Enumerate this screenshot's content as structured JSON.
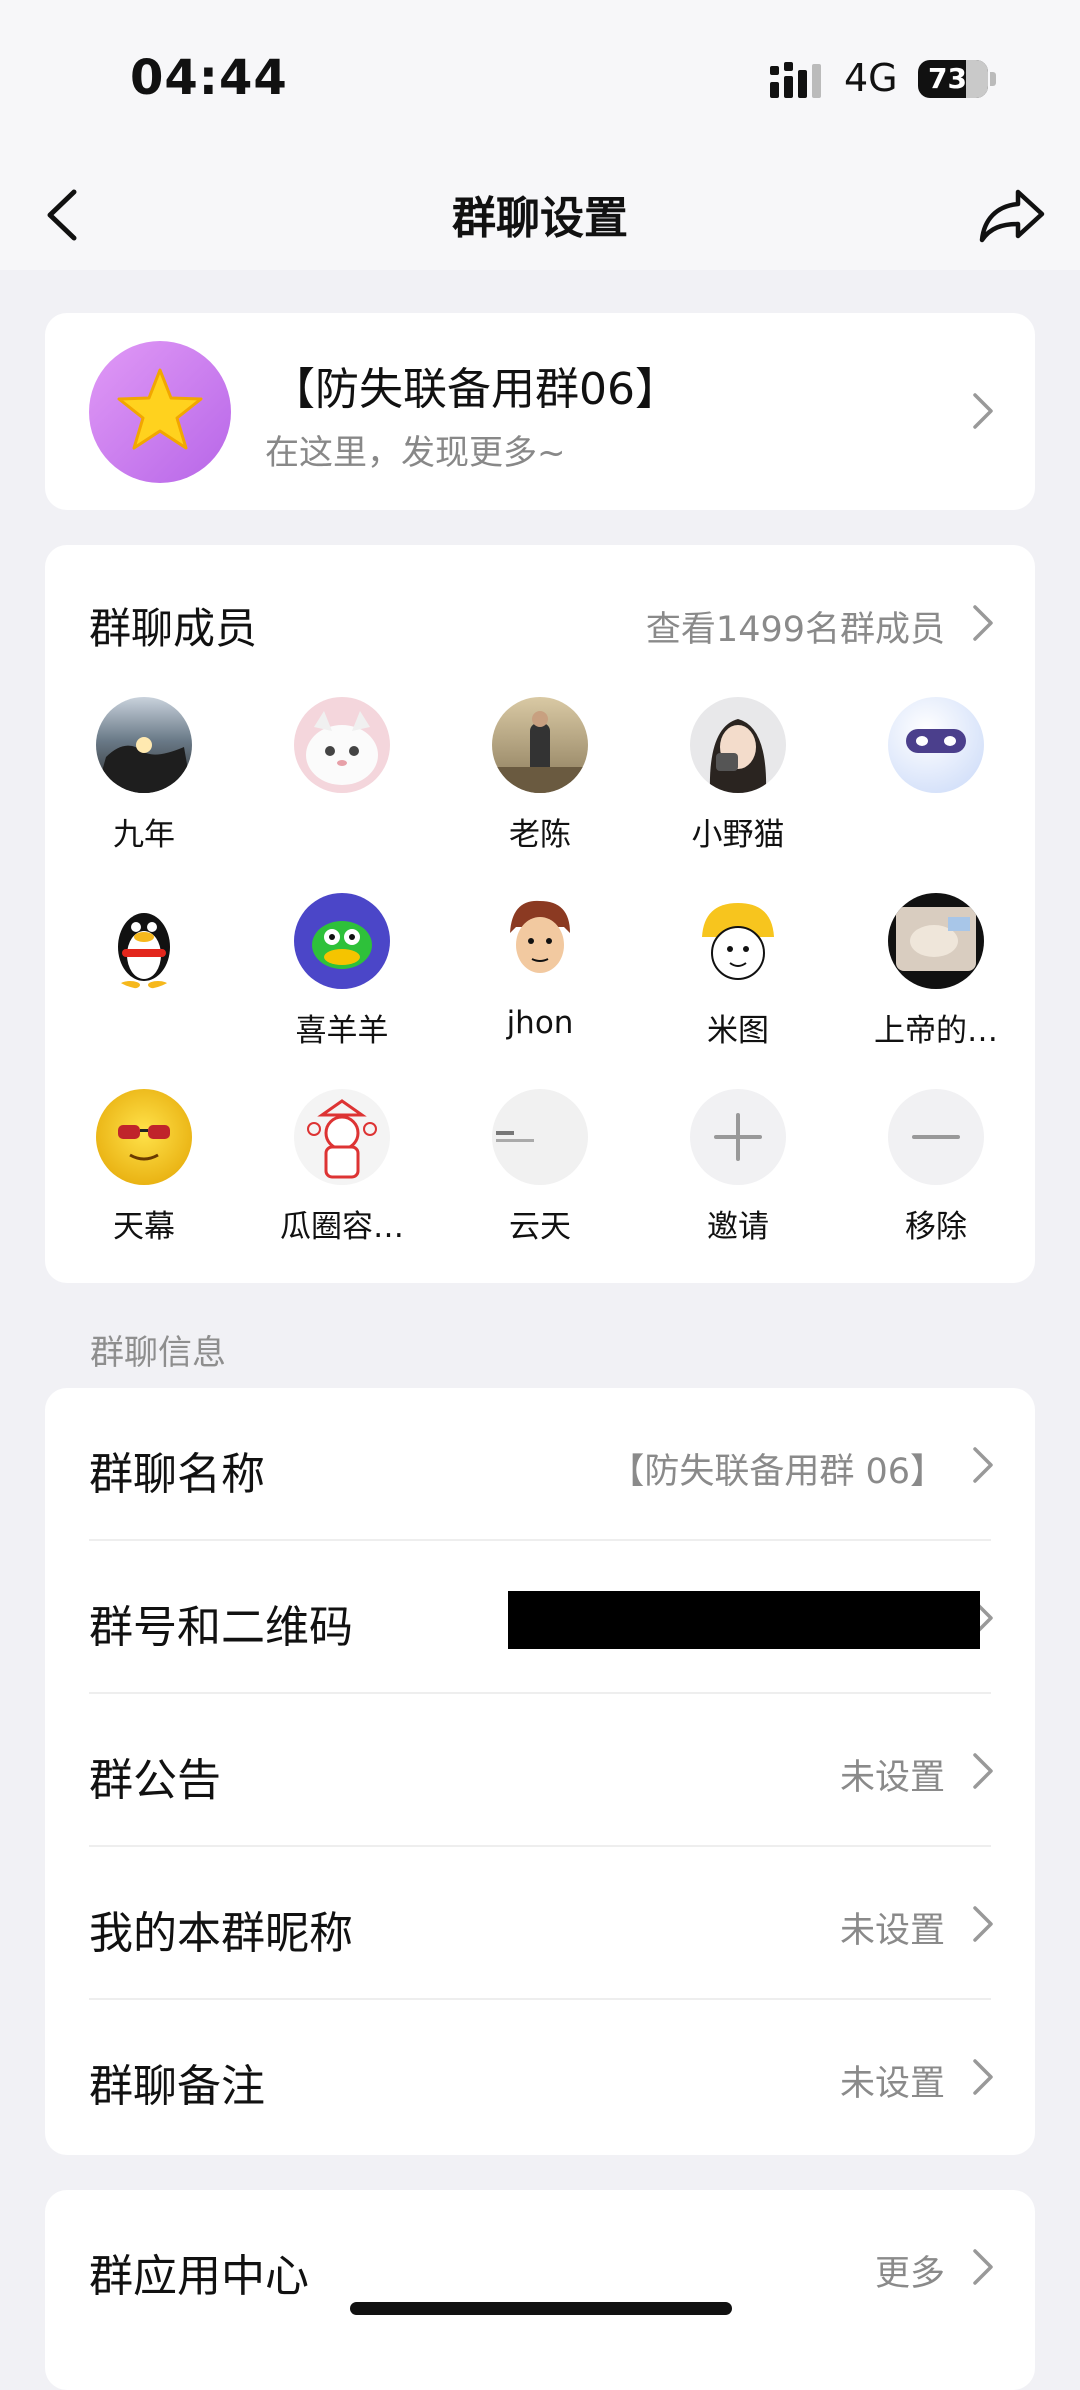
{
  "status_bar": {
    "time": "04:44",
    "network": "4G",
    "battery": "73"
  },
  "nav": {
    "title": "群聊设置"
  },
  "group": {
    "name": "【防失联备用群06】",
    "subtitle": "在这里，发现更多~"
  },
  "members": {
    "title": "群聊成员",
    "view_all": "查看1499名群成员",
    "items": [
      {
        "name": "九年"
      },
      {
        "name": ""
      },
      {
        "name": "老陈"
      },
      {
        "name": "小野猫"
      },
      {
        "name": ""
      },
      {
        "name": ""
      },
      {
        "name": "喜羊羊"
      },
      {
        "name": "jhon"
      },
      {
        "name": "米图"
      },
      {
        "name": "上帝的…"
      },
      {
        "name": "天幕"
      },
      {
        "name": "瓜圈容…"
      },
      {
        "name": "云天"
      },
      {
        "name": "邀请"
      },
      {
        "name": "移除"
      }
    ]
  },
  "info": {
    "section_label": "群聊信息",
    "rows": [
      {
        "label": "群聊名称",
        "value": "【防失联备用群 06】"
      },
      {
        "label": "群号和二维码",
        "value": ""
      },
      {
        "label": "群公告",
        "value": "未设置"
      },
      {
        "label": "我的本群昵称",
        "value": "未设置"
      },
      {
        "label": "群聊备注",
        "value": "未设置"
      }
    ]
  },
  "apps": {
    "label": "群应用中心",
    "value": "更多"
  }
}
